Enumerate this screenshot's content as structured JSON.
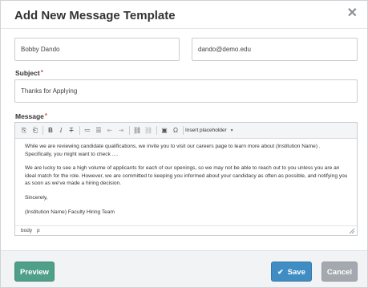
{
  "dialog": {
    "title": "Add New Message Template",
    "close_glyph": "✕"
  },
  "form": {
    "from_name": "Bobby Dando",
    "from_email": "dando@demo.edu",
    "subject_label": "Subject",
    "subject_value": "Thanks for Applying",
    "message_label": "Message",
    "required_mark": "*"
  },
  "toolbar": {
    "buttons": [
      {
        "name": "paste-icon",
        "glyph": "⎘"
      },
      {
        "name": "paste-text-icon",
        "glyph": "⎗"
      },
      {
        "name": "bold-icon",
        "glyph": "B"
      },
      {
        "name": "italic-icon",
        "glyph": "I"
      },
      {
        "name": "remove-format-icon",
        "glyph": "T"
      },
      {
        "name": "numbered-list-icon",
        "glyph": "≔"
      },
      {
        "name": "bulleted-list-icon",
        "glyph": "☰"
      },
      {
        "name": "outdent-icon",
        "glyph": "⇤"
      },
      {
        "name": "indent-icon",
        "glyph": "⇥"
      },
      {
        "name": "link-icon",
        "glyph": "⛓"
      },
      {
        "name": "unlink-icon",
        "glyph": "⛓"
      },
      {
        "name": "image-icon",
        "glyph": "▣"
      },
      {
        "name": "special-char-icon",
        "glyph": "Ω"
      }
    ],
    "insert_placeholder": "Insert placeholder"
  },
  "message": {
    "paragraphs": [
      "While we are reviewing candidate qualifications, we invite you to visit our careers page to learn more about (Institution Name) . Specifically, you might want to check ....",
      "We are lucky to see a high volume of applicants for each of our openings, so we may not be able to reach out to you unless you are an ideal match for the role. However, we are committed to keeping you informed about your candidacy as often as possible, and notifying you as soon as we've made a hiring decision.",
      "Sincerely,",
      "(Institution Name)  Faculty Hiring Team"
    ]
  },
  "statusbar": {
    "path": [
      "body",
      "p"
    ]
  },
  "footer": {
    "preview_label": "Preview",
    "save_label": "Save",
    "cancel_label": "Cancel"
  },
  "colors": {
    "preview": "#4f9f89",
    "save": "#3f8dc2",
    "cancel": "#a3a9ae",
    "required": "#d9534f"
  }
}
